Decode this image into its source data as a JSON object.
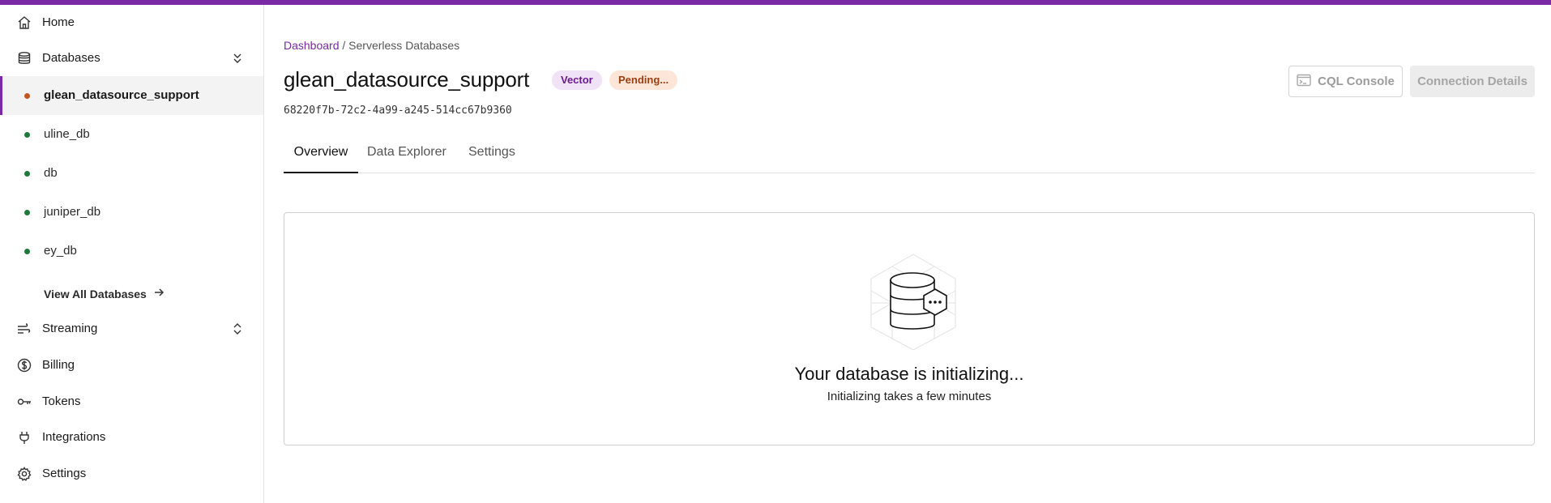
{
  "sidebar": {
    "home": {
      "label": "Home",
      "icon": "home-icon"
    },
    "databases": {
      "label": "Databases",
      "icon": "database-icon"
    },
    "db_items": [
      {
        "label": "glean_datasource_support",
        "status": "pending",
        "active": true
      },
      {
        "label": "uline_db",
        "status": "active"
      },
      {
        "label": "db",
        "status": "active"
      },
      {
        "label": "juniper_db",
        "status": "active"
      },
      {
        "label": "ey_db",
        "status": "active"
      }
    ],
    "view_all": "View All Databases",
    "streaming": {
      "label": "Streaming",
      "icon": "streaming-icon"
    },
    "billing": {
      "label": "Billing",
      "icon": "dollar-icon"
    },
    "tokens": {
      "label": "Tokens",
      "icon": "key-icon"
    },
    "integrations": {
      "label": "Integrations",
      "icon": "plug-icon"
    },
    "settings": {
      "label": "Settings",
      "icon": "gear-icon"
    }
  },
  "breadcrumb": {
    "link": "Dashboard",
    "separator": " / ",
    "current": "Serverless Databases"
  },
  "header": {
    "title": "glean_datasource_support",
    "badge_vector": "Vector",
    "badge_pending": "Pending...",
    "db_id": "68220f7b-72c2-4a99-a245-514cc67b9360",
    "cql_console": "CQL Console",
    "connection_details": "Connection Details"
  },
  "tabs": [
    {
      "label": "Overview",
      "active": true
    },
    {
      "label": "Data Explorer"
    },
    {
      "label": "Settings"
    }
  ],
  "status_card": {
    "title": "Your database is initializing...",
    "subtitle": "Initializing takes a few minutes",
    "icon": "database-initializing-icon"
  },
  "colors": {
    "accent": "#7b2aa6",
    "status_active": "#1e7a3a",
    "status_pending": "#c2571d"
  }
}
